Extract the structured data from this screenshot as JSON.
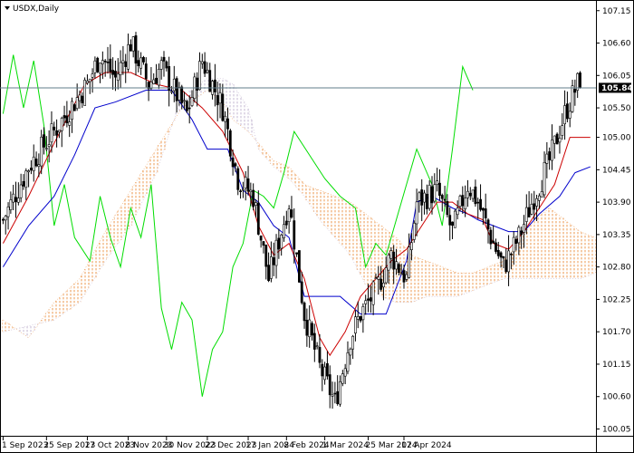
{
  "chart_data": {
    "type": "candlestick",
    "title": "USDX,Daily",
    "last_price_label": "105.84",
    "last_price": 105.84,
    "ylim": [
      99.95,
      107.3
    ],
    "grid": false,
    "y_ticks": [
      "107.15",
      "106.60",
      "106.05",
      "105.50",
      "105.00",
      "104.45",
      "103.90",
      "103.35",
      "102.80",
      "102.25",
      "101.70",
      "101.15",
      "100.60",
      "100.05"
    ],
    "x_ticks": [
      "1 Sep 2023",
      "25 Sep 2023",
      "17 Oct 2023",
      "8 Nov 2023",
      "30 Nov 2023",
      "22 Dec 2023",
      "17 Jan 2024",
      "8 Feb 2024",
      "1 Mar 2024",
      "25 Mar 2024",
      "17 Apr 2024"
    ],
    "colors": {
      "bull_candle": "#ffffff",
      "bear_candle": "#000000",
      "candle_outline": "#000000",
      "tenkan": "#cc0000",
      "kijun": "#0000cc",
      "chikou": "#00dd00",
      "kumo_bullish": "#e8822a",
      "kumo_bearish": "#b8a8c8",
      "price_line": "#607d8b",
      "price_badge": "#000000",
      "axis": "#000000"
    },
    "series": [
      {
        "name": "close",
        "points": [
          [
            0,
            103.6
          ],
          [
            10,
            104.5
          ],
          [
            20,
            105.1
          ],
          [
            28,
            105.6
          ],
          [
            33,
            105.9
          ],
          [
            38,
            106.4
          ],
          [
            44,
            106.0
          ],
          [
            50,
            106.6
          ],
          [
            57,
            105.9
          ],
          [
            62,
            106.2
          ],
          [
            72,
            105.4
          ],
          [
            78,
            106.3
          ],
          [
            86,
            105.5
          ],
          [
            92,
            104.3
          ],
          [
            98,
            104.0
          ],
          [
            104,
            102.6
          ],
          [
            112,
            103.9
          ],
          [
            118,
            102.0
          ],
          [
            124,
            101.1
          ],
          [
            130,
            100.5
          ],
          [
            136,
            101.6
          ],
          [
            140,
            102.0
          ],
          [
            146,
            102.4
          ],
          [
            152,
            103.0
          ],
          [
            158,
            102.6
          ],
          [
            162,
            103.9
          ],
          [
            170,
            104.1
          ],
          [
            176,
            103.4
          ],
          [
            182,
            104.2
          ],
          [
            186,
            103.9
          ],
          [
            192,
            103.2
          ],
          [
            196,
            102.8
          ],
          [
            202,
            103.3
          ],
          [
            208,
            104.0
          ],
          [
            214,
            104.6
          ],
          [
            220,
            105.4
          ],
          [
            226,
            106.0
          ],
          [
            230,
            105.8
          ]
        ]
      },
      {
        "name": "tenkan",
        "points": [
          [
            0,
            103.2
          ],
          [
            10,
            104.0
          ],
          [
            20,
            104.9
          ],
          [
            26,
            105.4
          ],
          [
            32,
            105.9
          ],
          [
            40,
            106.1
          ],
          [
            50,
            106.1
          ],
          [
            60,
            105.9
          ],
          [
            70,
            105.8
          ],
          [
            78,
            105.5
          ],
          [
            86,
            105.1
          ],
          [
            94,
            104.4
          ],
          [
            100,
            103.5
          ],
          [
            106,
            103.0
          ],
          [
            112,
            103.2
          ],
          [
            118,
            102.6
          ],
          [
            124,
            101.6
          ],
          [
            128,
            101.3
          ],
          [
            134,
            101.7
          ],
          [
            140,
            102.3
          ],
          [
            146,
            102.6
          ],
          [
            152,
            102.9
          ],
          [
            158,
            103.1
          ],
          [
            164,
            103.5
          ],
          [
            170,
            103.9
          ],
          [
            176,
            103.9
          ],
          [
            182,
            103.7
          ],
          [
            188,
            103.6
          ],
          [
            192,
            103.2
          ],
          [
            198,
            103.1
          ],
          [
            204,
            103.4
          ],
          [
            210,
            103.8
          ],
          [
            216,
            104.2
          ],
          [
            222,
            105.0
          ],
          [
            230,
            105.0
          ]
        ]
      },
      {
        "name": "kijun",
        "points": [
          [
            0,
            102.8
          ],
          [
            10,
            103.5
          ],
          [
            20,
            104.0
          ],
          [
            28,
            104.7
          ],
          [
            36,
            105.5
          ],
          [
            44,
            105.6
          ],
          [
            56,
            105.8
          ],
          [
            66,
            105.8
          ],
          [
            74,
            105.3
          ],
          [
            80,
            104.8
          ],
          [
            88,
            104.8
          ],
          [
            94,
            104.1
          ],
          [
            100,
            103.9
          ],
          [
            106,
            103.5
          ],
          [
            112,
            103.3
          ],
          [
            118,
            102.3
          ],
          [
            132,
            102.3
          ],
          [
            140,
            102.0
          ],
          [
            150,
            102.0
          ],
          [
            158,
            102.9
          ],
          [
            162,
            103.9
          ],
          [
            168,
            104.0
          ],
          [
            176,
            103.8
          ],
          [
            182,
            103.7
          ],
          [
            186,
            103.6
          ],
          [
            192,
            103.5
          ],
          [
            198,
            103.4
          ],
          [
            204,
            103.4
          ],
          [
            210,
            103.7
          ],
          [
            218,
            104.0
          ],
          [
            224,
            104.4
          ],
          [
            230,
            104.5
          ]
        ]
      },
      {
        "name": "chikou",
        "points": [
          [
            0,
            105.4
          ],
          [
            4,
            106.4
          ],
          [
            8,
            105.5
          ],
          [
            12,
            106.3
          ],
          [
            16,
            105.2
          ],
          [
            20,
            103.5
          ],
          [
            24,
            104.2
          ],
          [
            28,
            103.3
          ],
          [
            34,
            102.9
          ],
          [
            38,
            104.0
          ],
          [
            42,
            103.3
          ],
          [
            46,
            102.8
          ],
          [
            50,
            103.8
          ],
          [
            54,
            103.3
          ],
          [
            58,
            104.2
          ],
          [
            62,
            102.1
          ],
          [
            66,
            101.4
          ],
          [
            70,
            102.2
          ],
          [
            74,
            101.9
          ],
          [
            78,
            100.6
          ],
          [
            82,
            101.4
          ],
          [
            86,
            101.7
          ],
          [
            90,
            102.8
          ],
          [
            94,
            103.2
          ],
          [
            98,
            104.1
          ],
          [
            102,
            104.0
          ],
          [
            106,
            103.8
          ],
          [
            110,
            104.4
          ],
          [
            114,
            105.1
          ],
          [
            120,
            104.7
          ],
          [
            126,
            104.3
          ],
          [
            132,
            104.0
          ],
          [
            138,
            103.8
          ],
          [
            142,
            102.8
          ],
          [
            146,
            103.2
          ],
          [
            150,
            103.0
          ],
          [
            154,
            103.6
          ],
          [
            158,
            104.2
          ],
          [
            162,
            104.8
          ],
          [
            168,
            104.2
          ],
          [
            172,
            103.5
          ],
          [
            176,
            104.8
          ],
          [
            180,
            106.2
          ],
          [
            184,
            105.8
          ]
        ]
      },
      {
        "name": "kumo_span_a",
        "points": [
          [
            0,
            101.9
          ],
          [
            10,
            101.6
          ],
          [
            20,
            102.2
          ],
          [
            30,
            102.6
          ],
          [
            40,
            103.4
          ],
          [
            50,
            104.1
          ],
          [
            60,
            104.8
          ],
          [
            70,
            105.5
          ],
          [
            80,
            105.8
          ],
          [
            86,
            105.6
          ],
          [
            90,
            105.3
          ],
          [
            96,
            105.1
          ],
          [
            100,
            104.9
          ],
          [
            106,
            104.6
          ],
          [
            112,
            104.5
          ],
          [
            118,
            104.2
          ],
          [
            124,
            104.1
          ],
          [
            130,
            104.0
          ],
          [
            136,
            103.9
          ],
          [
            142,
            103.7
          ],
          [
            148,
            103.5
          ],
          [
            154,
            103.3
          ],
          [
            160,
            103.0
          ],
          [
            166,
            102.9
          ],
          [
            172,
            102.8
          ],
          [
            178,
            102.7
          ],
          [
            184,
            102.7
          ],
          [
            190,
            102.8
          ],
          [
            196,
            102.9
          ],
          [
            202,
            103.2
          ],
          [
            208,
            103.6
          ],
          [
            214,
            103.8
          ],
          [
            220,
            103.6
          ],
          [
            226,
            103.4
          ],
          [
            232,
            103.3
          ]
        ]
      },
      {
        "name": "kumo_span_b",
        "points": [
          [
            0,
            101.7
          ],
          [
            10,
            101.8
          ],
          [
            20,
            101.9
          ],
          [
            30,
            102.2
          ],
          [
            40,
            102.9
          ],
          [
            50,
            103.5
          ],
          [
            60,
            104.4
          ],
          [
            70,
            105.7
          ],
          [
            80,
            106.0
          ],
          [
            86,
            106.0
          ],
          [
            90,
            105.9
          ],
          [
            96,
            105.5
          ],
          [
            100,
            104.8
          ],
          [
            106,
            104.5
          ],
          [
            112,
            104.3
          ],
          [
            118,
            104.0
          ],
          [
            124,
            103.6
          ],
          [
            130,
            103.3
          ],
          [
            136,
            103.0
          ],
          [
            142,
            102.5
          ],
          [
            148,
            102.3
          ],
          [
            154,
            102.2
          ],
          [
            160,
            102.2
          ],
          [
            166,
            102.3
          ],
          [
            172,
            102.3
          ],
          [
            178,
            102.3
          ],
          [
            184,
            102.4
          ],
          [
            190,
            102.5
          ],
          [
            196,
            102.6
          ],
          [
            202,
            102.6
          ],
          [
            208,
            102.6
          ],
          [
            214,
            102.6
          ],
          [
            220,
            102.6
          ],
          [
            226,
            102.6
          ],
          [
            232,
            102.7
          ]
        ]
      }
    ]
  }
}
